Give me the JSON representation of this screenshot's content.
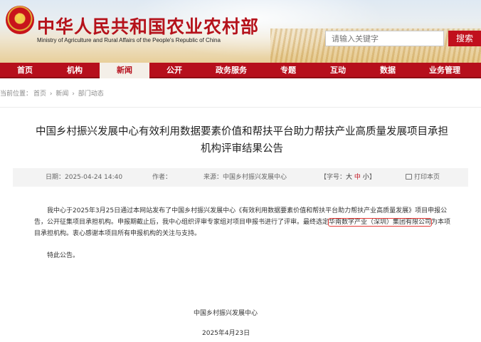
{
  "header": {
    "title": "中华人民共和国农业农村部",
    "subtitle_en": "Ministry of Agriculture and Rural Affairs of the People's Republic of China",
    "search_placeholder": "请输入关键字",
    "search_button": "搜索",
    "emblem_icon": "national-emblem-icon"
  },
  "nav": {
    "items": [
      "首页",
      "机构",
      "新闻",
      "公开",
      "政务服务",
      "专题",
      "互动",
      "数据",
      "业务管理"
    ],
    "active_index": 2,
    "color": "#b60f1c"
  },
  "breadcrumb": {
    "label": "当前位置：",
    "items": [
      "首页",
      "新闻",
      "部门动态"
    ],
    "separator": "›"
  },
  "article": {
    "title_line1": "中国乡村振兴发展中心有效利用数据要素价值和帮扶平台助力帮扶产业高质量发展项目承担",
    "title_line2": "机构评审结果公告",
    "meta": {
      "date": "日期：2025-04-24 14:40",
      "author": "作者：",
      "source": "来源：中国乡村振兴发展中心",
      "font_size_label": "【字号：",
      "size_big": "大",
      "size_mid": "中",
      "size_small": "小",
      "font_size_close": "】",
      "print": "打印本页",
      "print_icon": "printer-icon"
    },
    "body": {
      "p1_part1": "我中心于2025年3月25日通过本网站发布了中国乡村振兴发展中心《有效利用数据要素价值和帮扶平台助力帮扶产业高质量发展》项目申报公告，公开征集项目承担机构。申报期截止后，我中心组织评审专家组对项目申报书进行了评审。最终选定",
      "p1_highlight": "华南数字产业（深圳）集团有限公司",
      "p1_part2": "为本项目承担机构。衷心感谢本项目所有申报机构的关注与支持。",
      "notice": "特此公告。",
      "signature_org": "中国乡村振兴发展中心",
      "signature_date": "2025年4月23日",
      "highlight_color": "#e53935"
    }
  }
}
